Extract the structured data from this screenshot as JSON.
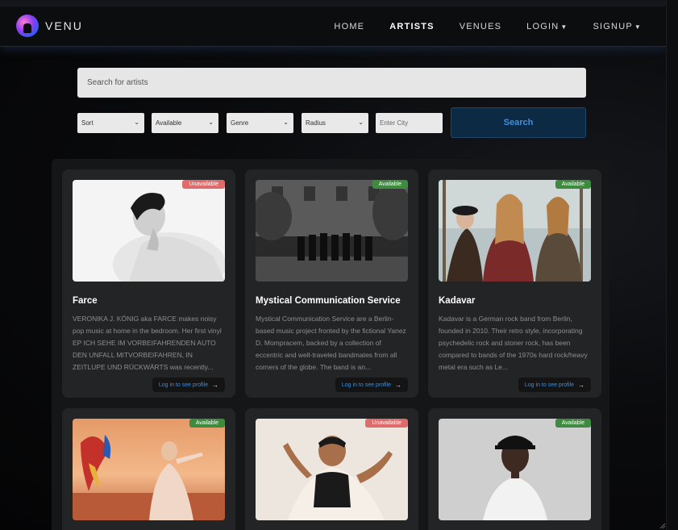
{
  "brand": {
    "name": "VENU"
  },
  "nav": {
    "home": "HOME",
    "artists": "ARTISTS",
    "venues": "VENUES",
    "login": "LOGIN",
    "signup": "SIGNUP"
  },
  "search": {
    "placeholder": "Search for artists",
    "sort": "Sort",
    "availability": "Available",
    "genre": "Genre",
    "radius": "Radius",
    "city_placeholder": "Enter City",
    "button": "Search"
  },
  "colors": {
    "unavailable": "#e06b6b",
    "available": "#3e8a3e",
    "link": "#3d8fdc"
  },
  "cards": [
    {
      "name": "Farce",
      "status": "Unavailable",
      "description": "VERONIKA J. KÖNIG aka FARCE makes noisy pop music at home in the bedroom. Her first vinyl EP ICH SEHE IM VORBEIFAHRENDEN AUTO DEN UNFALL MITVORBEIFAHREN, IN ZEITLUPE UND RÜCKWÄRTS was recently...",
      "link": "Log in to see profile"
    },
    {
      "name": "Mystical Communication Service",
      "status": "Available",
      "description": "Mystical Communication Service are a Berlin-based music project fronted by the fictional Yanez D. Mompracem, backed by a collection of eccentric and well-traveled bandmates from all corners of the globe. The band is an...",
      "link": "Log in to see profile"
    },
    {
      "name": "Kadavar",
      "status": "Available",
      "description": "Kadavar is a German rock band from Berlin, founded in 2010. Their retro style, incorporating psychedelic rock and stoner rock, has been compared to bands of the 1970s hard rock/heavy metal era such as Le...",
      "link": "Log in to see profile"
    },
    {
      "status": "Available"
    },
    {
      "status": "Unavailable"
    },
    {
      "status": "Available"
    }
  ]
}
